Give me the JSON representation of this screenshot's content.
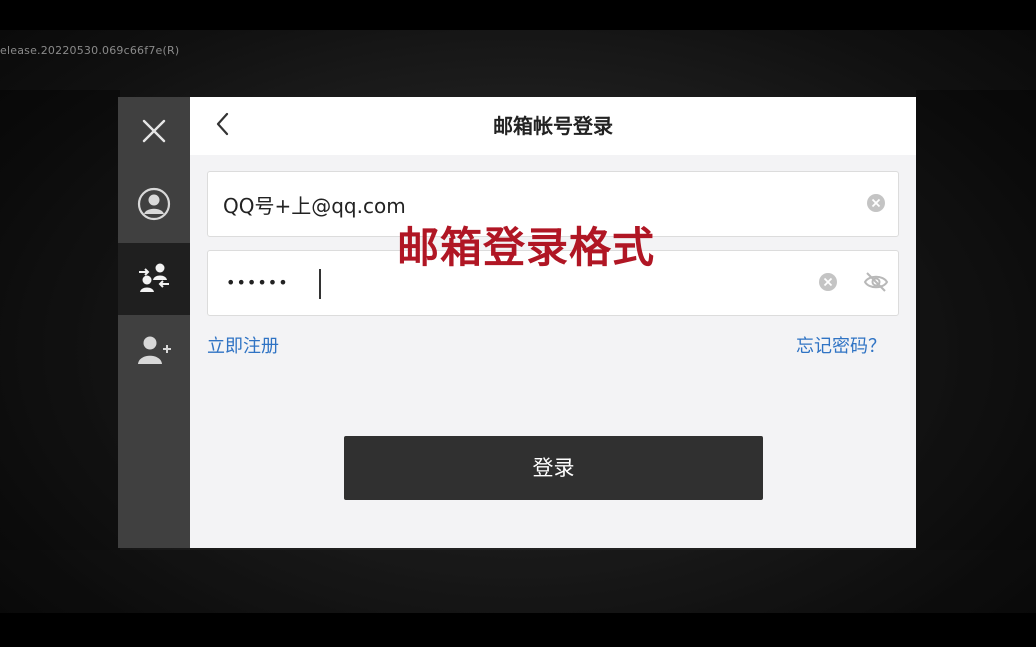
{
  "version_text": "elease.20220530.069c66f7e(R)",
  "rail": {
    "items": [
      {
        "name": "close-icon"
      },
      {
        "name": "user-icon"
      },
      {
        "name": "switch-account-icon",
        "active": true
      },
      {
        "name": "add-user-icon"
      }
    ]
  },
  "panel": {
    "title": "邮箱帐号登录",
    "email": {
      "value": "QQ号+上@qq.com"
    },
    "password": {
      "masked_value": "••••••"
    },
    "register_link": "立即注册",
    "forgot_link": "忘记密码？",
    "login_button": "登录"
  },
  "overlay_caption": "邮箱登录格式",
  "colors": {
    "link": "#2f73c4",
    "caption": "#b01624",
    "login_button": "#303030",
    "rail": "#404040",
    "rail_active": "#1f1f1f"
  }
}
